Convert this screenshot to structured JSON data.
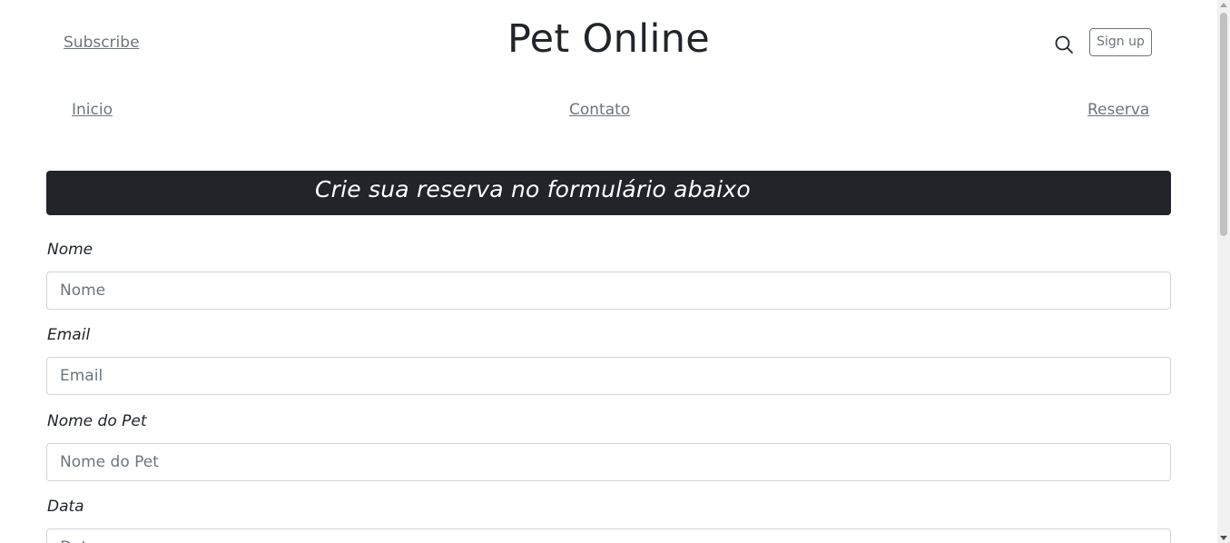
{
  "header": {
    "subscribe_label": "Subscribe",
    "brand_title": "Pet Online",
    "search_icon": "search-icon",
    "signup_label": "Sign up"
  },
  "nav": {
    "items": [
      {
        "label": "Inicio"
      },
      {
        "label": "Contato"
      },
      {
        "label": "Reserva"
      }
    ]
  },
  "banner": {
    "text": "Crie sua reserva no formulário abaixo",
    "background": "#212529"
  },
  "form": {
    "fields": [
      {
        "label": "Nome",
        "placeholder": "Nome",
        "value": ""
      },
      {
        "label": "Email",
        "placeholder": "Email",
        "value": ""
      },
      {
        "label": "Nome do Pet",
        "placeholder": "Nome do Pet",
        "value": ""
      },
      {
        "label": "Data",
        "placeholder": "Data",
        "value": ""
      }
    ]
  }
}
